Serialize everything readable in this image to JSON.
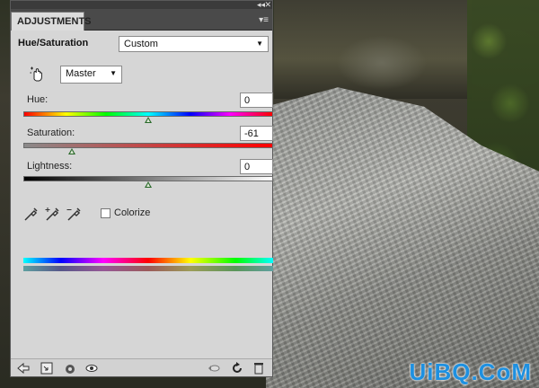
{
  "panel": {
    "title": "ADJUSTMENTS",
    "adjustment_type": "Hue/Saturation",
    "preset": "Custom",
    "channel": "Master"
  },
  "sliders": {
    "hue": {
      "label": "Hue:",
      "value": "0",
      "position": 0.5
    },
    "saturation": {
      "label": "Saturation:",
      "value": "-61",
      "position": 0.195
    },
    "lightness": {
      "label": "Lightness:",
      "value": "0",
      "position": 0.5
    }
  },
  "colorize": {
    "label": "Colorize",
    "checked": false
  },
  "watermark": "UiBQ.CoM",
  "icons": {
    "top": [
      "collapse-icon",
      "close-icon",
      "panel-menu-icon"
    ],
    "tools": [
      "hand-target-icon",
      "eyedropper-icon",
      "eyedropper-plus-icon",
      "eyedropper-minus-icon"
    ],
    "footer": [
      "back-icon",
      "clip-layer-icon",
      "visibility-eye-icon",
      "view-previous-icon",
      "reset-icon",
      "trash-icon"
    ]
  }
}
